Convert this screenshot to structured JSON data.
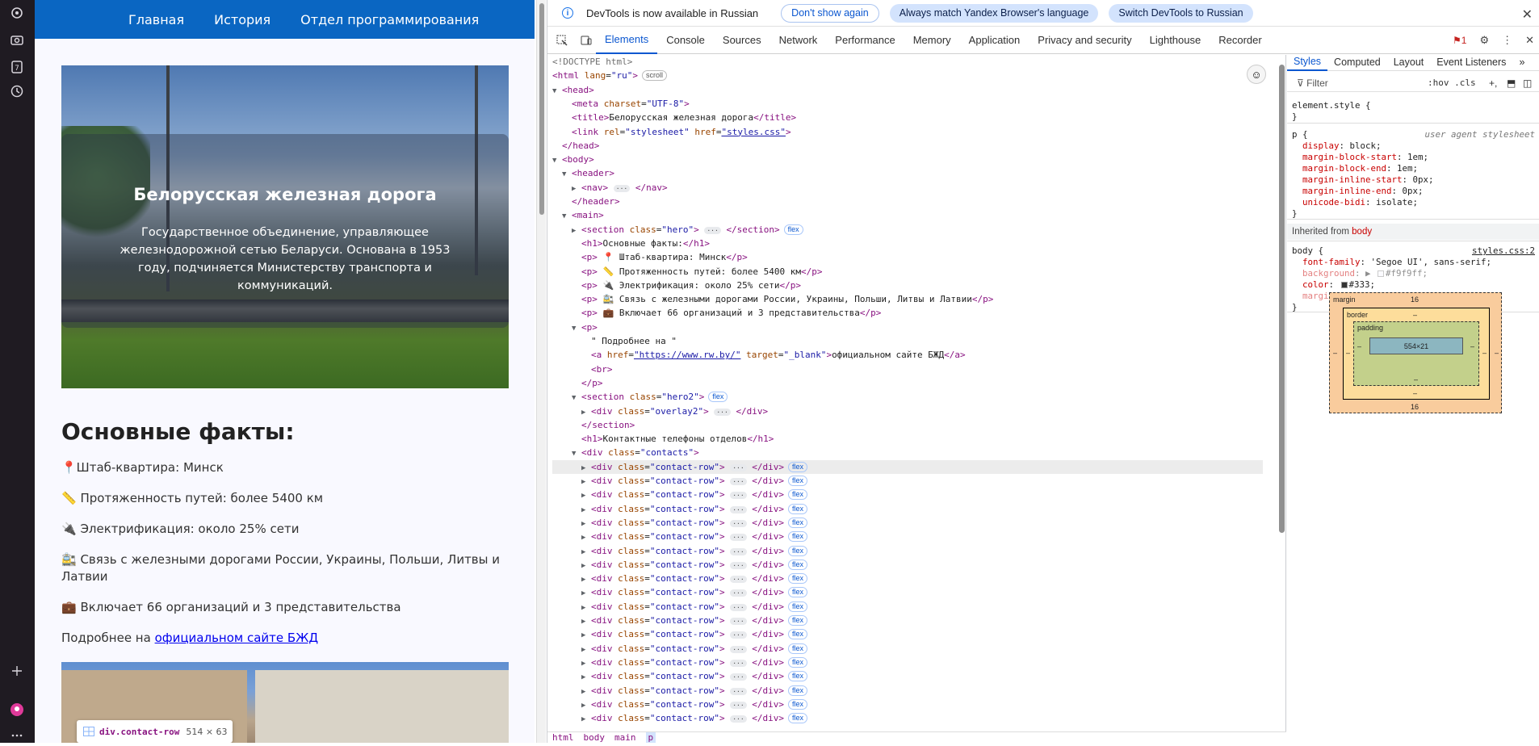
{
  "page": {
    "nav": [
      "Главная",
      "История",
      "Отдел программирования"
    ],
    "hero_title": "Белорусская железная дорога",
    "hero_text": "Государственное объединение, управляющее железнодорожной сетью Беларуси. Основана в 1953 году, подчиняется Министерству транспорта и коммуникаций.",
    "facts_title": "Основные факты:",
    "facts": [
      "📍Штаб-квартира: Минск",
      "📏 Протяженность путей: более 5400 км",
      "🔌 Электрификация: около 25% сети",
      "🚉 Связь с железными дорогами России, Украины, Польши, Литвы и Латвии",
      "💼 Включает 66 организаций и 3 представительства"
    ],
    "more_prefix": "Подробнее на ",
    "more_link": "официальном сайте БЖД",
    "tooltip_tag": "div.contact-row",
    "tooltip_dim": "514 × 63"
  },
  "devtools": {
    "info_text": "DevTools is now available in Russian",
    "btn_dont_show": "Don't show again",
    "btn_match": "Always match Yandex Browser's language",
    "btn_switch": "Switch DevTools to Russian",
    "tabs": [
      "Elements",
      "Console",
      "Sources",
      "Network",
      "Performance",
      "Memory",
      "Application",
      "Privacy and security",
      "Lighthouse",
      "Recorder"
    ],
    "issues_count": "1",
    "styles_tabs": [
      "Styles",
      "Computed",
      "Layout",
      "Event Listeners"
    ],
    "filter_placeholder": "Filter",
    "hov": ":hov  .cls",
    "crumbs": [
      "html",
      "body",
      "main",
      "p"
    ],
    "box": {
      "margin_label": "margin",
      "margin_top": "16",
      "margin_bottom": "16",
      "border_label": "border",
      "border_val": "–",
      "padding_label": "padding",
      "padding_val": "–",
      "content": "554×21",
      "side": "–"
    }
  },
  "colors": {
    "accent": "#0b57d0",
    "nav_bg": "#0a66c2",
    "tag": "#881280",
    "attr": "#994500",
    "attr_value": "#1a1aa6"
  }
}
